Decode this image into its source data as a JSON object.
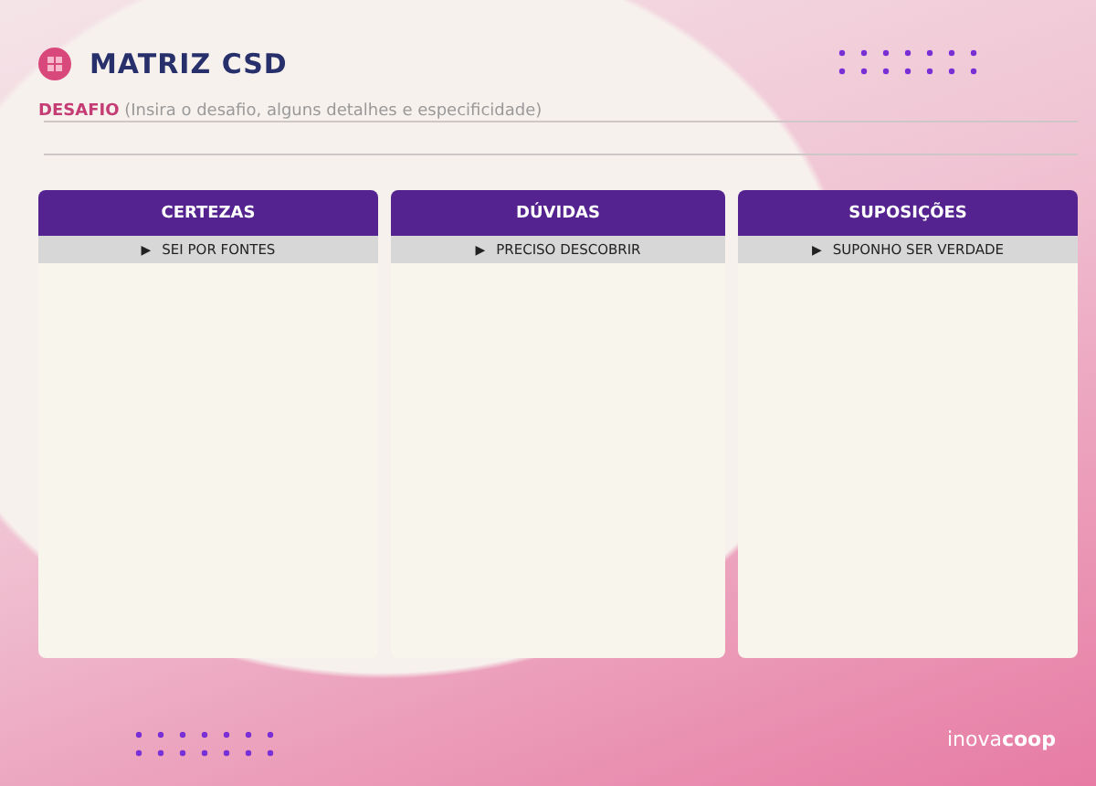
{
  "title": "MATRIZ CSD",
  "challenge": {
    "label": "DESAFIO",
    "hint": "(Insira o desafio, alguns detalhes e especificidade)"
  },
  "columns": [
    {
      "title": "CERTEZAS",
      "subtitle": "SEI POR FONTES",
      "marker": "▶"
    },
    {
      "title": "DÚVIDAS",
      "subtitle": "PRECISO DESCOBRIR",
      "marker": "▶"
    },
    {
      "title": "SUPOSIÇÕES",
      "subtitle": "SUPONHO SER VERDADE",
      "marker": "▶"
    }
  ],
  "brand": {
    "light": "inova",
    "bold": "coop"
  }
}
